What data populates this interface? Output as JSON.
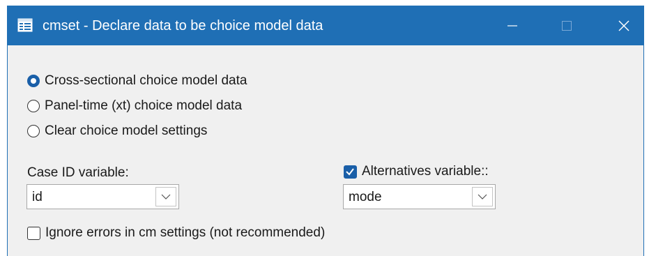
{
  "window": {
    "title": "cmset - Declare data to be choice model data",
    "icon": "dialog-form-icon",
    "controls": [
      "minimize",
      "maximize",
      "close"
    ],
    "titlebar_color": "#1f6fb5"
  },
  "options": {
    "radio": [
      {
        "label": "Cross-sectional choice model data",
        "selected": true
      },
      {
        "label": "Panel-time (xt) choice model data",
        "selected": false
      },
      {
        "label": "Clear choice model settings",
        "selected": false
      }
    ]
  },
  "case_id": {
    "label": "Case ID variable:",
    "value": "id"
  },
  "alternatives": {
    "label": "Alternatives variable::",
    "checked": true,
    "value": "mode"
  },
  "ignore_errors": {
    "label": "Ignore errors in cm settings (not recommended)",
    "checked": false
  },
  "accent_color": "#1a5fa8"
}
